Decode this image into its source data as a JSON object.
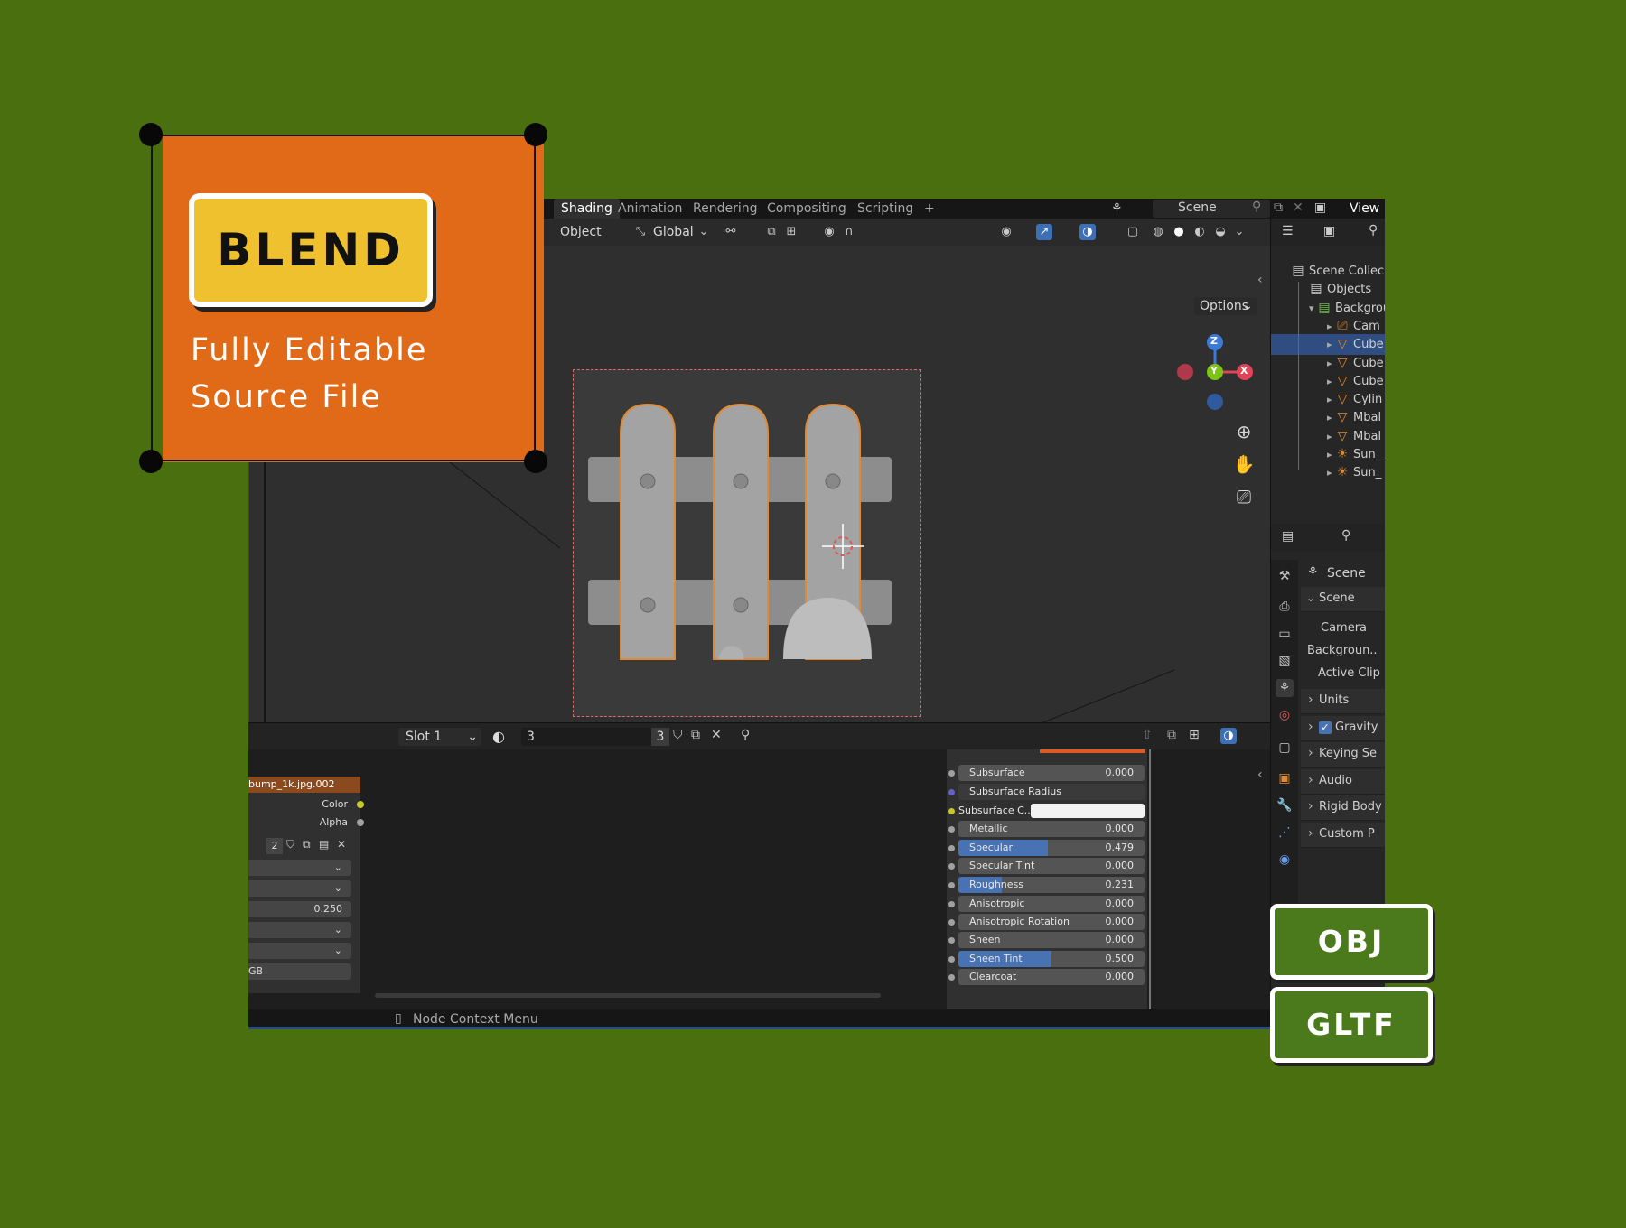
{
  "badge": {
    "title": "BLEND",
    "subtitle_line1": "Fully Editable",
    "subtitle_line2": "Source File"
  },
  "formats": [
    "OBJ",
    "GLTF"
  ],
  "topbar": {
    "tabs": [
      "Shading",
      "Animation",
      "Rendering",
      "Compositing",
      "Scripting"
    ],
    "active_tab": "Shading",
    "add_tab": "+",
    "scene_name": "Scene",
    "view_layer": "View L"
  },
  "toolbar": {
    "mode": "Object",
    "transform_orientation": "Global",
    "options_label": "Options"
  },
  "editor_header": {
    "slot": "Slot 1",
    "image_name": "3",
    "image_users": "3"
  },
  "texture_node": {
    "title": "bump_1k.jpg.002",
    "outputs": [
      "Color",
      "Alpha"
    ],
    "users": "2",
    "value": "0.250",
    "bottom_label": "GB"
  },
  "bsdf_inputs": [
    {
      "label": "Subsurface",
      "value": "0.000",
      "fill": 0
    },
    {
      "label": "Subsurface Radius",
      "value": "",
      "fill": 0
    },
    {
      "label": "Subsurface C...",
      "value": "",
      "fill": 0
    },
    {
      "label": "Metallic",
      "value": "0.000",
      "fill": 0
    },
    {
      "label": "Specular",
      "value": "0.479",
      "fill": 0.479
    },
    {
      "label": "Specular Tint",
      "value": "0.000",
      "fill": 0
    },
    {
      "label": "Roughness",
      "value": "0.231",
      "fill": 0.231
    },
    {
      "label": "Anisotropic",
      "value": "0.000",
      "fill": 0
    },
    {
      "label": "Anisotropic Rotation",
      "value": "0.000",
      "fill": 0
    },
    {
      "label": "Sheen",
      "value": "0.000",
      "fill": 0
    },
    {
      "label": "Sheen Tint",
      "value": "0.500",
      "fill": 0.5
    },
    {
      "label": "Clearcoat",
      "value": "0.000",
      "fill": 0
    }
  ],
  "status_bar": {
    "hint": "Node Context Menu"
  },
  "outliner": {
    "rows": [
      {
        "label": "Scene Collec",
        "icon": "collection-icon"
      },
      {
        "label": "Objects",
        "icon": "collection-icon"
      },
      {
        "label": "Backgrou",
        "icon": "collection-icon"
      },
      {
        "label": "Cam",
        "icon": "camera-icon"
      },
      {
        "label": "Cube",
        "icon": "mesh-icon",
        "selected": true
      },
      {
        "label": "Cube",
        "icon": "mesh-icon"
      },
      {
        "label": "Cube",
        "icon": "mesh-icon"
      },
      {
        "label": "Cylin",
        "icon": "mesh-icon"
      },
      {
        "label": "Mbal",
        "icon": "mesh-icon"
      },
      {
        "label": "Mbal",
        "icon": "mesh-icon"
      },
      {
        "label": "Sun_",
        "icon": "light-icon"
      },
      {
        "label": "Sun_",
        "icon": "light-icon"
      }
    ]
  },
  "properties": {
    "context": "Scene",
    "panel_title": "Scene",
    "fields": [
      "Camera",
      "Backgroun..",
      "Active Clip"
    ],
    "panels": [
      "Units",
      "Gravity",
      "Keying Se",
      "Audio",
      "Rigid Body",
      "Custom P"
    ],
    "gravity_checked": true
  },
  "gizmo_axes": {
    "z": "Z",
    "y": "Y",
    "x": "X"
  },
  "colors": {
    "background": "#4a6f0e",
    "badge": "#e06a17",
    "blend_box": "#f0c12f",
    "format_box": "#4a7a1c",
    "selection": "#4772b3"
  }
}
